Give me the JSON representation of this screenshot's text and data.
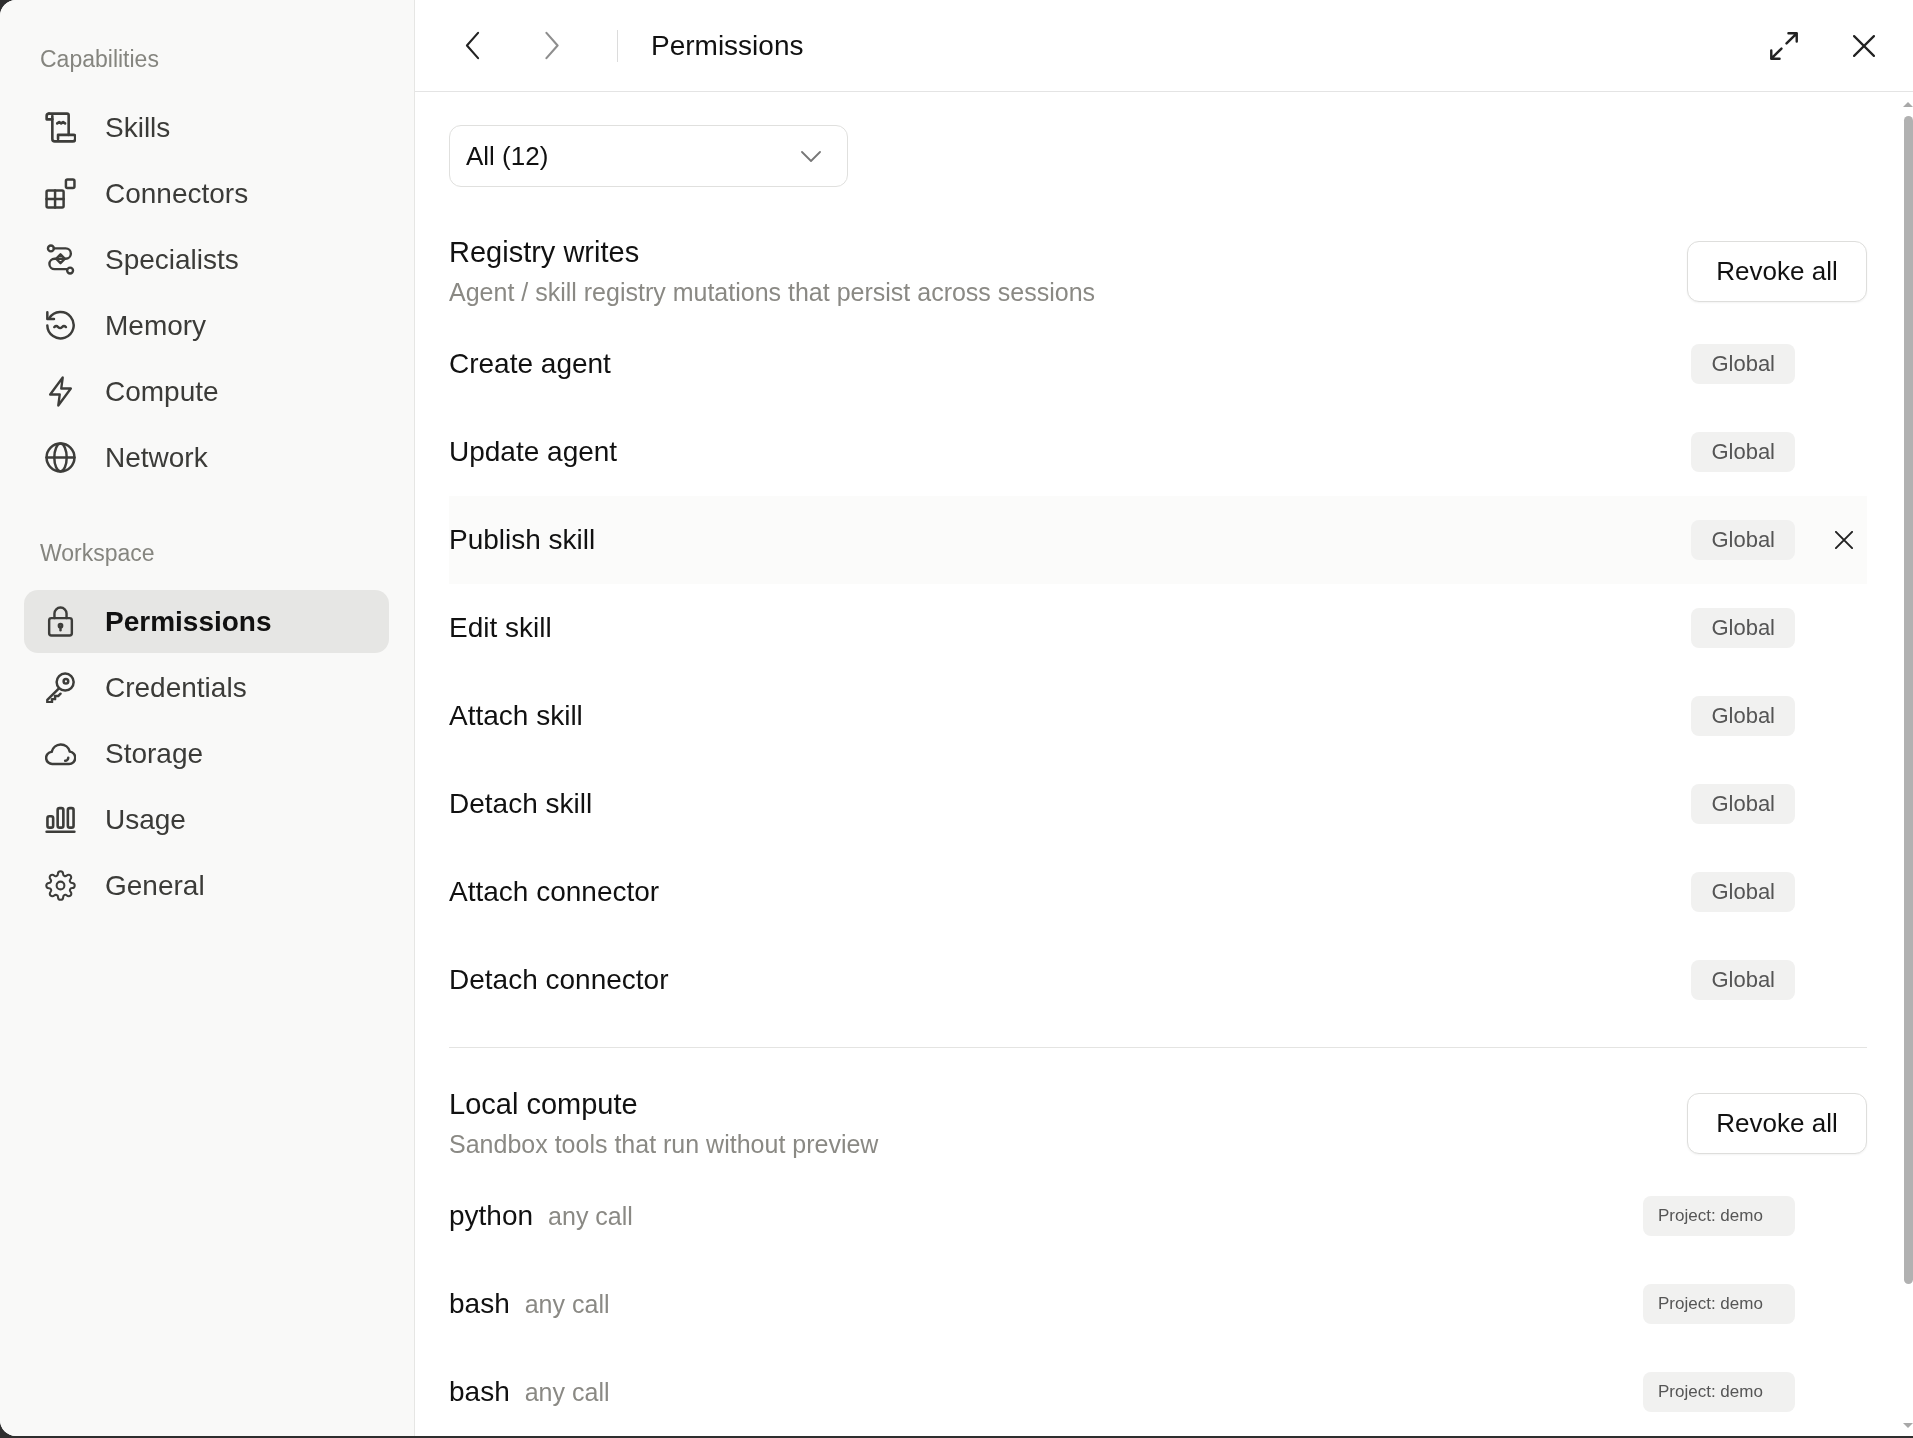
{
  "sidebar": {
    "sections": [
      {
        "title": "Capabilities",
        "items": [
          {
            "label": "Skills",
            "selected": false
          },
          {
            "label": "Connectors",
            "selected": false
          },
          {
            "label": "Specialists",
            "selected": false
          },
          {
            "label": "Memory",
            "selected": false
          },
          {
            "label": "Compute",
            "selected": false
          },
          {
            "label": "Network",
            "selected": false
          }
        ]
      },
      {
        "title": "Workspace",
        "items": [
          {
            "label": "Permissions",
            "selected": true
          },
          {
            "label": "Credentials",
            "selected": false
          },
          {
            "label": "Storage",
            "selected": false
          },
          {
            "label": "Usage",
            "selected": false
          },
          {
            "label": "General",
            "selected": false
          }
        ]
      }
    ]
  },
  "header": {
    "nav": [
      {
        "kind": "back",
        "disabled": false
      },
      {
        "kind": "forward",
        "disabled": true
      }
    ],
    "title": "Permissions"
  },
  "filter": {
    "value": "All (12)"
  },
  "sections": [
    {
      "kind": "registry",
      "title": "Registry writes",
      "subtitle": "Agent / skill registry mutations that persist across sessions",
      "action": "Revoke all",
      "rows": [
        {
          "name": "Create agent",
          "scope": "Global",
          "hovered": false
        },
        {
          "name": "Update agent",
          "scope": "Global",
          "hovered": false
        },
        {
          "name": "Publish skill",
          "scope": "Global",
          "hovered": true
        },
        {
          "name": "Edit skill",
          "scope": "Global",
          "hovered": false
        },
        {
          "name": "Attach skill",
          "scope": "Global",
          "hovered": false
        },
        {
          "name": "Detach skill",
          "scope": "Global",
          "hovered": false
        },
        {
          "name": "Attach connector",
          "scope": "Global",
          "hovered": false
        },
        {
          "name": "Detach connector",
          "scope": "Global",
          "hovered": false
        }
      ]
    },
    {
      "kind": "tools",
      "title": "Local compute",
      "subtitle": "Sandbox tools that run without preview",
      "action": "Revoke all",
      "rows": [
        {
          "name": "python",
          "detail": "any call",
          "scope": "Project: demo",
          "hovered": false
        },
        {
          "name": "bash",
          "detail": "any call",
          "scope": "Project: demo",
          "hovered": false
        },
        {
          "name": "bash",
          "detail": "any call",
          "scope": "Project: demo",
          "hovered": false
        }
      ]
    }
  ]
}
